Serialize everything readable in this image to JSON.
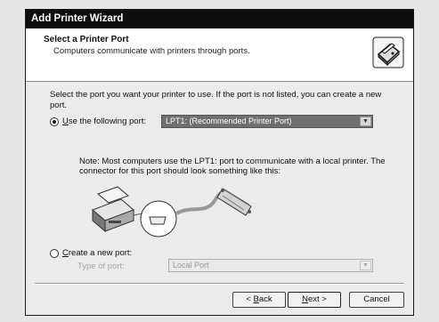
{
  "window": {
    "title": "Add Printer Wizard"
  },
  "header": {
    "title": "Select a Printer Port",
    "subtitle": "Computers communicate with printers through ports."
  },
  "body": {
    "intro": "Select the port you want your printer to use.  If the port is not listed, you can create a new port.",
    "use_port": {
      "label_prefix": "",
      "label_mnemonic": "U",
      "label_rest": "se the following port:",
      "selected": true,
      "value": "LPT1: (Recommended Printer Port)"
    },
    "note": "Note: Most computers use the LPT1: port to communicate with a local printer. The connector for this port should look something like this:",
    "create_port": {
      "label_mnemonic": "C",
      "label_rest": "reate a new port:",
      "selected": false,
      "type_label": "Type of port:",
      "type_value": "Local Port"
    }
  },
  "buttons": {
    "back": {
      "mnemonic": "B",
      "prefix": "< ",
      "rest": "ack"
    },
    "next": {
      "mnemonic": "N",
      "rest": "ext >"
    },
    "cancel": "Cancel"
  },
  "icons": {
    "wizard": "printer-wizard-icon",
    "illustration": "printer-parallel-cable-illustration",
    "dropdown": "chevron-down-icon"
  }
}
